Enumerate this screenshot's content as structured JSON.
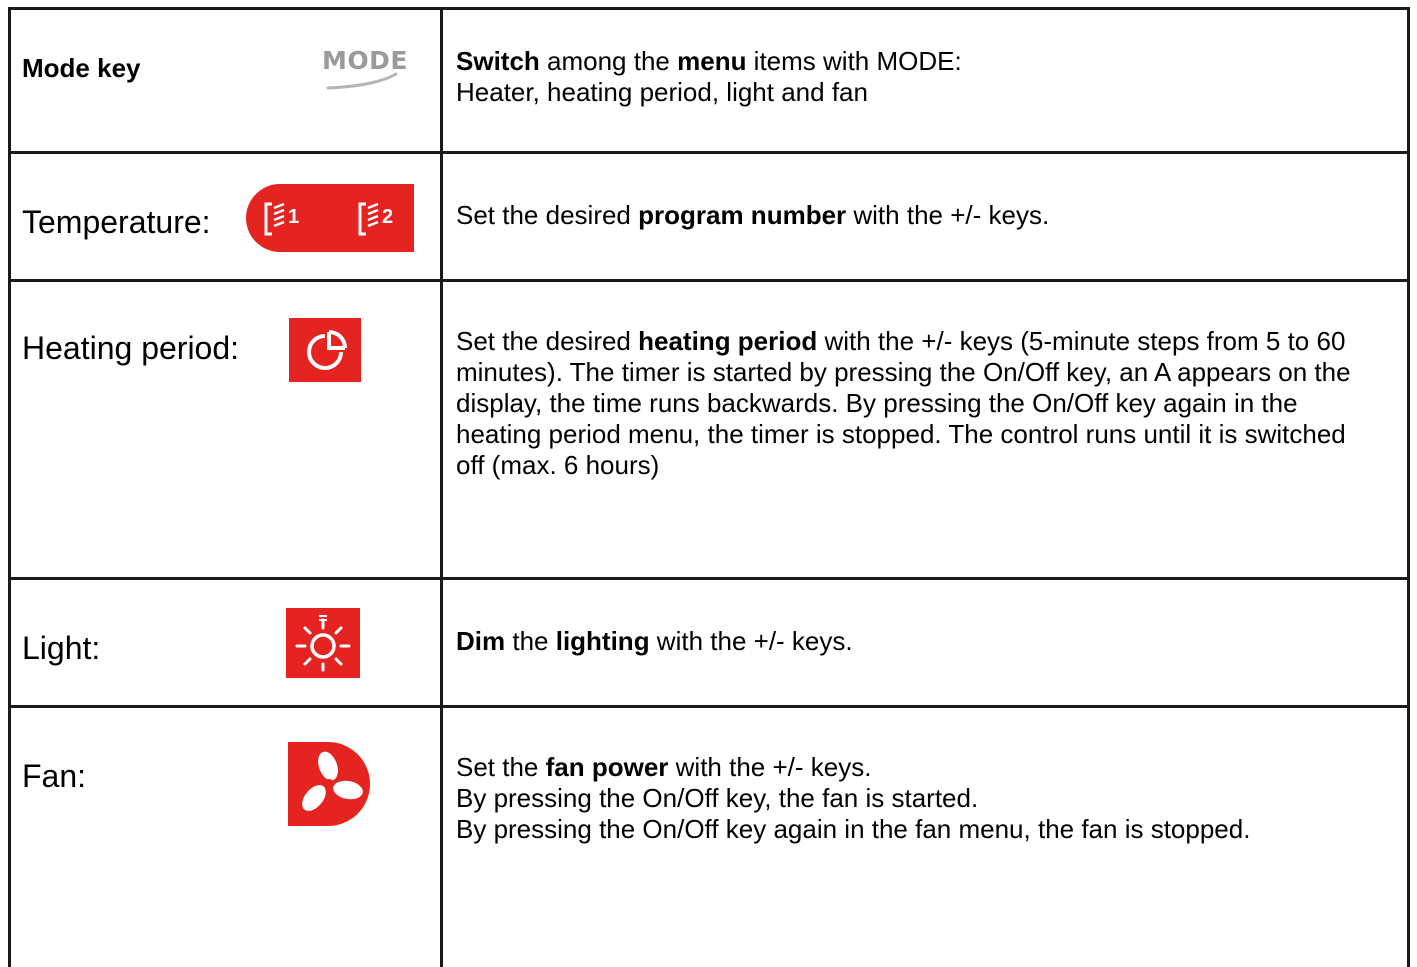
{
  "rows": [
    {
      "label": "Mode key",
      "icon": "mode-key-icon",
      "icon_text": "MODE",
      "desc_parts": [
        {
          "t": "Switch",
          "b": true
        },
        {
          "t": " among the ",
          "b": false
        },
        {
          "t": "menu",
          "b": true
        },
        {
          "t": " items with MODE:",
          "b": false
        }
      ],
      "desc_line2": "Heater, heating period, light and fan"
    },
    {
      "label": "Temperature:",
      "icon": "temperature-program-icon",
      "icon_text_1": "1",
      "icon_text_2": "2",
      "desc_parts": [
        {
          "t": "Set the desired ",
          "b": false
        },
        {
          "t": "program number",
          "b": true
        },
        {
          "t": " with the +/- keys.",
          "b": false
        }
      ]
    },
    {
      "label": "Heating period:",
      "icon": "timer-icon",
      "desc_parts": [
        {
          "t": "Set the desired ",
          "b": false
        },
        {
          "t": "heating period",
          "b": true
        },
        {
          "t": " with the +/- keys (5-minute steps from 5 to 60 minutes). The timer is started by pressing the On/Off key, an A appears on the display, the time runs backwards. By pressing the On/Off key again in the heating period menu, the timer is stopped. The control runs until it is switched off (max. 6 hours)",
          "b": false
        }
      ]
    },
    {
      "label": "Light:",
      "icon": "light-icon",
      "desc_parts": [
        {
          "t": "Dim",
          "b": true
        },
        {
          "t": " the ",
          "b": false
        },
        {
          "t": "lighting",
          "b": true
        },
        {
          "t": " with the +/- keys.",
          "b": false
        }
      ]
    },
    {
      "label": "Fan:",
      "icon": "fan-icon",
      "desc_parts": [
        {
          "t": "Set the ",
          "b": false
        },
        {
          "t": "fan power",
          "b": true
        },
        {
          "t": " with the +/- keys.",
          "b": false
        }
      ],
      "desc_line2": "By pressing the On/Off key, the fan is started.",
      "desc_line3": "By pressing the On/Off key again in the fan menu, the fan is stopped."
    }
  ],
  "colors": {
    "accent_red": "#e52421",
    "mode_grey": "#9a9a9a",
    "border": "#1a1a1a"
  }
}
